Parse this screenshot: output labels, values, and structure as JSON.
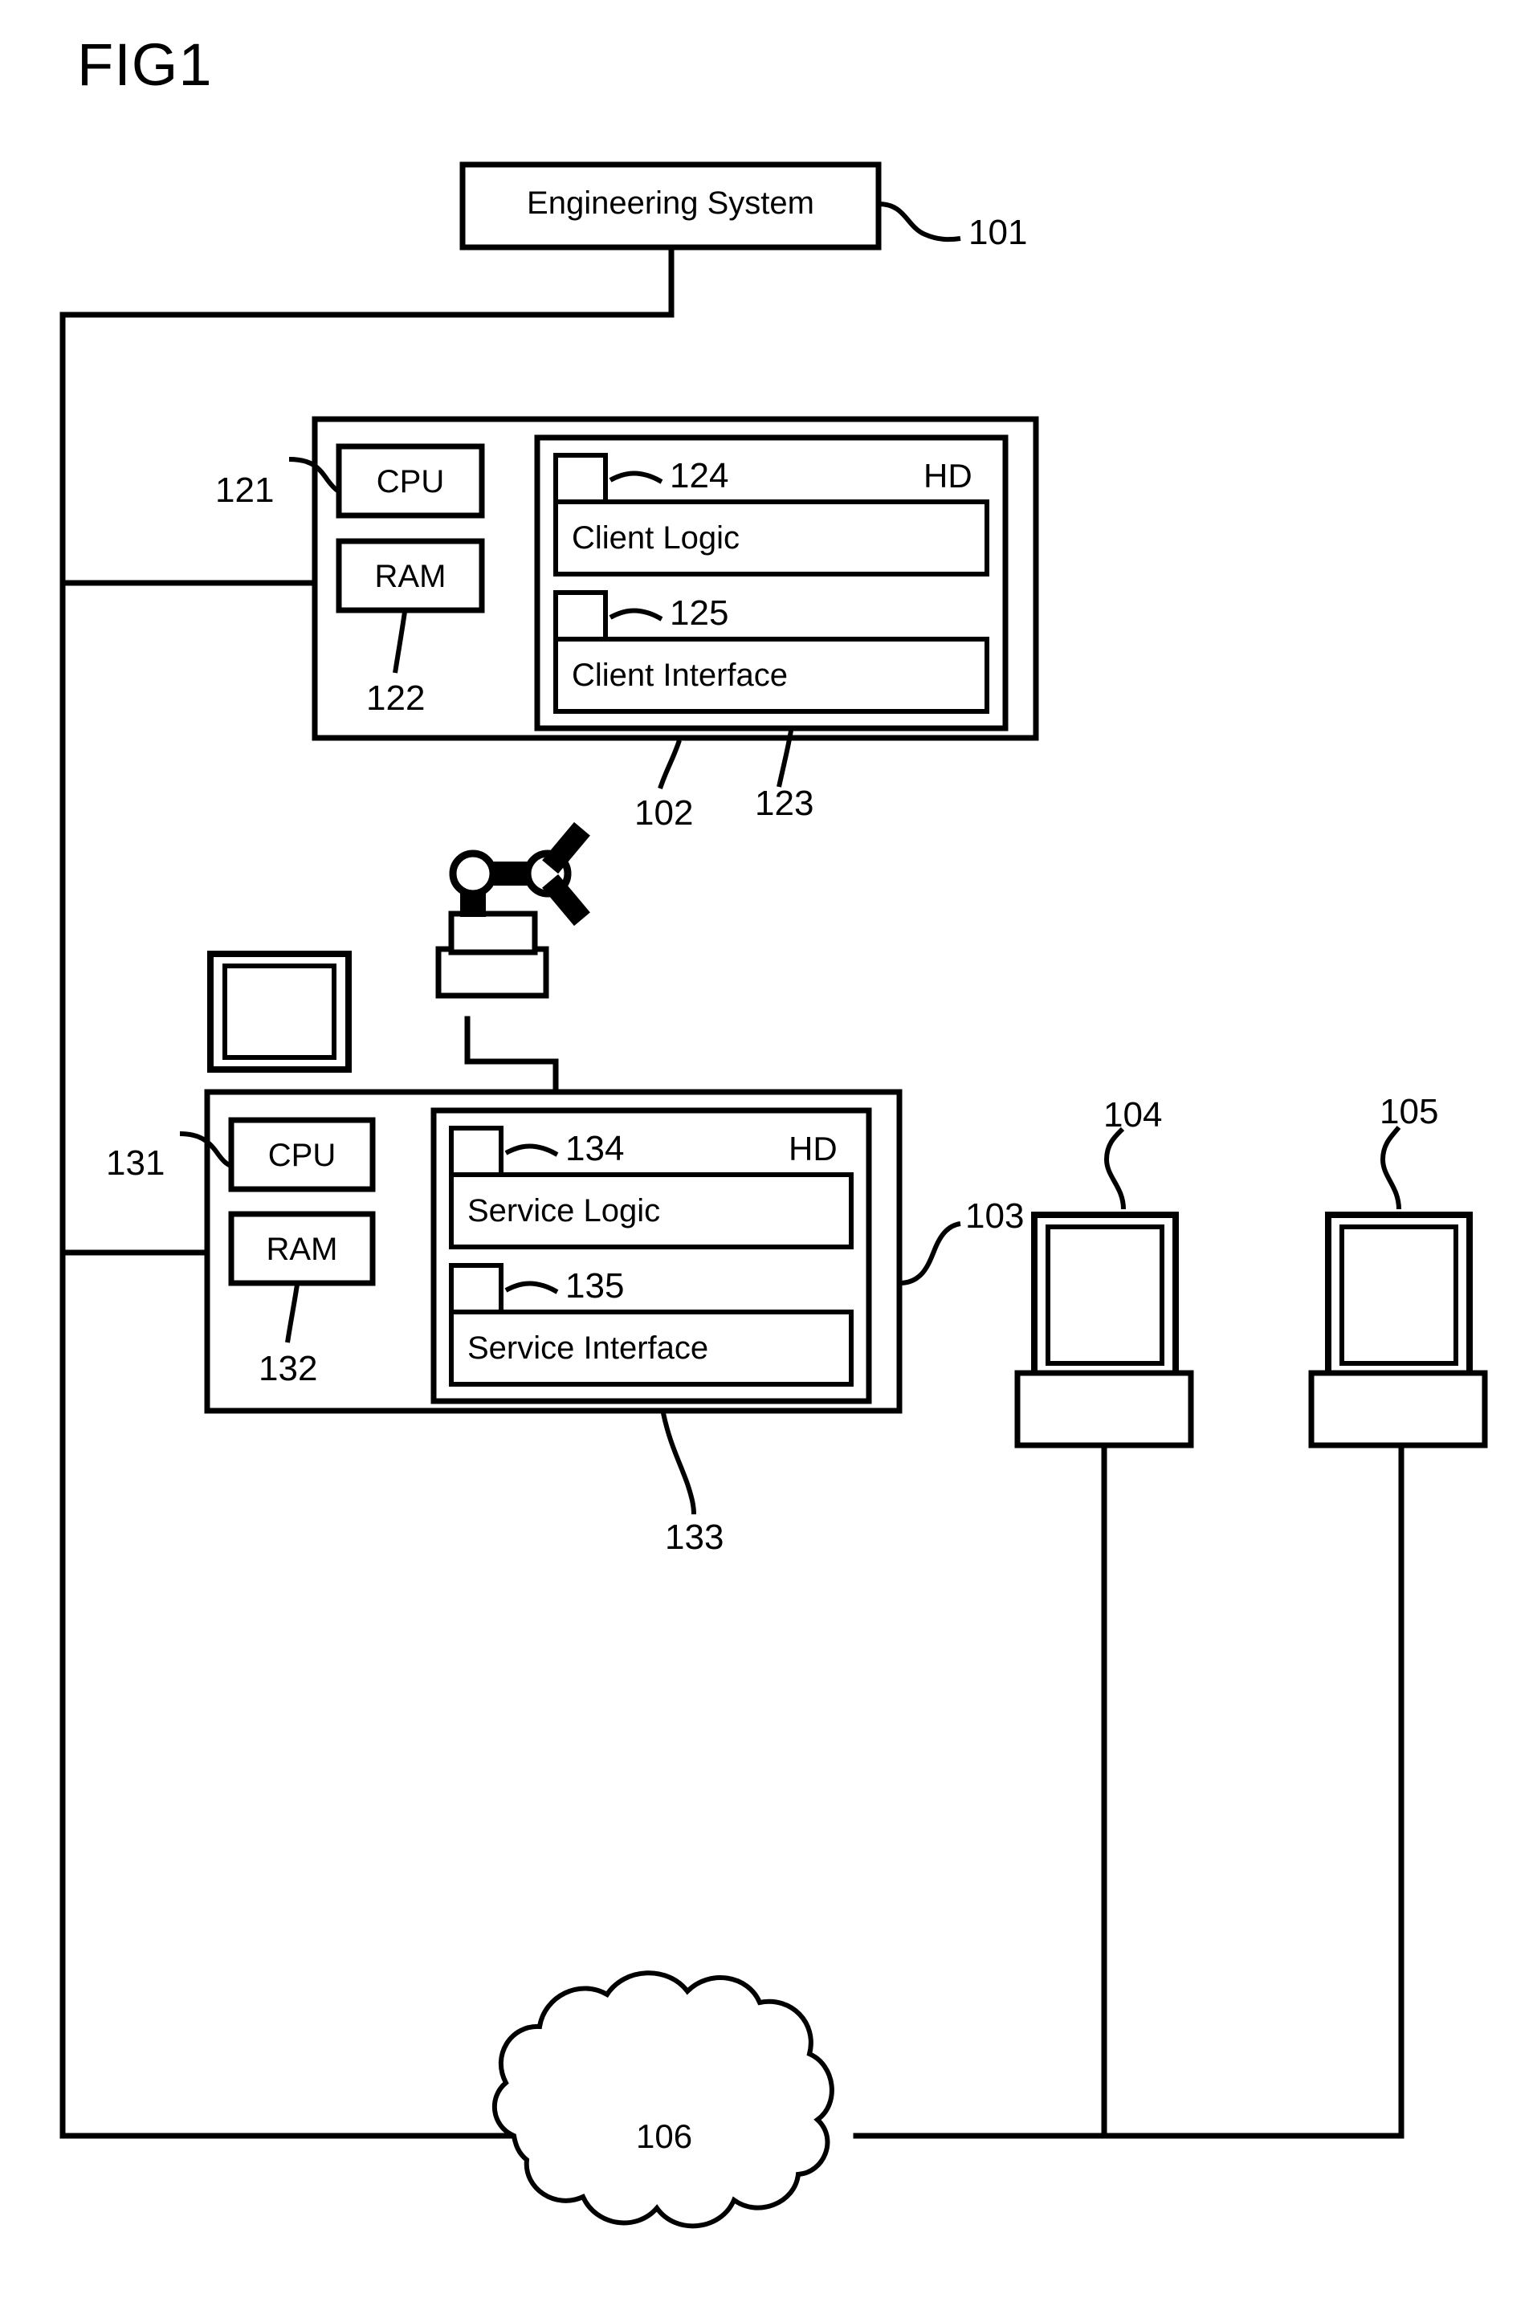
{
  "figure": {
    "title": "FIG1"
  },
  "nodes": {
    "engineering_system": {
      "label": "Engineering System",
      "ref": "101"
    },
    "client_station": {
      "ref": "102",
      "cpu_label": "CPU",
      "cpu_ref": "121",
      "ram_label": "RAM",
      "ram_ref": "122",
      "hd_label": "HD",
      "hd_ref": "123",
      "modules": [
        {
          "label": "Client Logic",
          "ref": "124"
        },
        {
          "label": "Client Interface",
          "ref": "125"
        }
      ]
    },
    "service_station": {
      "ref": "103",
      "cpu_label": "CPU",
      "cpu_ref": "131",
      "ram_label": "RAM",
      "ram_ref": "132",
      "hd_label": "HD",
      "hd_ref": "133",
      "modules": [
        {
          "label": "Service Logic",
          "ref": "134"
        },
        {
          "label": "Service Interface",
          "ref": "135"
        }
      ]
    },
    "terminal_one": {
      "ref": "104"
    },
    "terminal_two": {
      "ref": "105"
    },
    "network_cloud": {
      "ref": "106"
    }
  },
  "colors": {
    "stroke": "#000000",
    "fill": "#ffffff"
  }
}
